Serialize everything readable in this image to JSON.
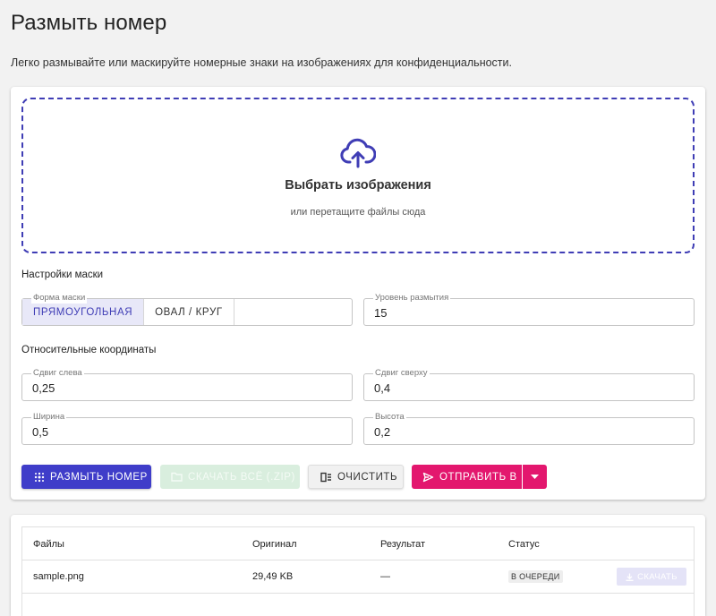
{
  "page": {
    "title": "Размыть номер",
    "description": "Легко размывайте или маскируйте номерные знаки на изображениях для конфиденциальности."
  },
  "upload": {
    "icon": "cloud-upload-icon",
    "title": "Выбрать изображения",
    "subtitle": "или перетащите файлы сюда",
    "accent": "#3f3db5"
  },
  "mask_settings": {
    "heading": "Настройки маски",
    "shape_label": "Форма маски",
    "shape_options": [
      "ПРЯМОУГОЛЬНАЯ",
      "ОВАЛ / КРУГ"
    ],
    "shape_selected": "ПРЯМОУГОЛЬНАЯ",
    "blur_label": "Уровень размытия",
    "blur_value": "15"
  },
  "coords": {
    "heading": "Относительные координаты",
    "offset_left_label": "Сдвиг слева",
    "offset_left_value": "0,25",
    "offset_top_label": "Сдвиг сверху",
    "offset_top_value": "0,4",
    "width_label": "Ширина",
    "width_value": "0,5",
    "height_label": "Высота",
    "height_value": "0,2"
  },
  "actions": {
    "blur_button": "РАЗМЫТЬ НОМЕР",
    "download_all_button": "СКАЧАТЬ ВСЁ (.ZIP)",
    "clear_button": "ОЧИСТИТЬ",
    "send_button": "ОТПРАВИТЬ В",
    "colors": {
      "primary": "#3f3dc9",
      "send": "#e3176e",
      "zip_disabled": "#d9eede"
    }
  },
  "files_table": {
    "columns": [
      "Файлы",
      "Оригинал",
      "Результат",
      "Статус"
    ],
    "rows": [
      {
        "file": "sample.png",
        "original": "29,49 KB",
        "result": "—",
        "status": "В ОЧЕРЕДИ",
        "action": "СКАЧАТЬ"
      }
    ]
  }
}
